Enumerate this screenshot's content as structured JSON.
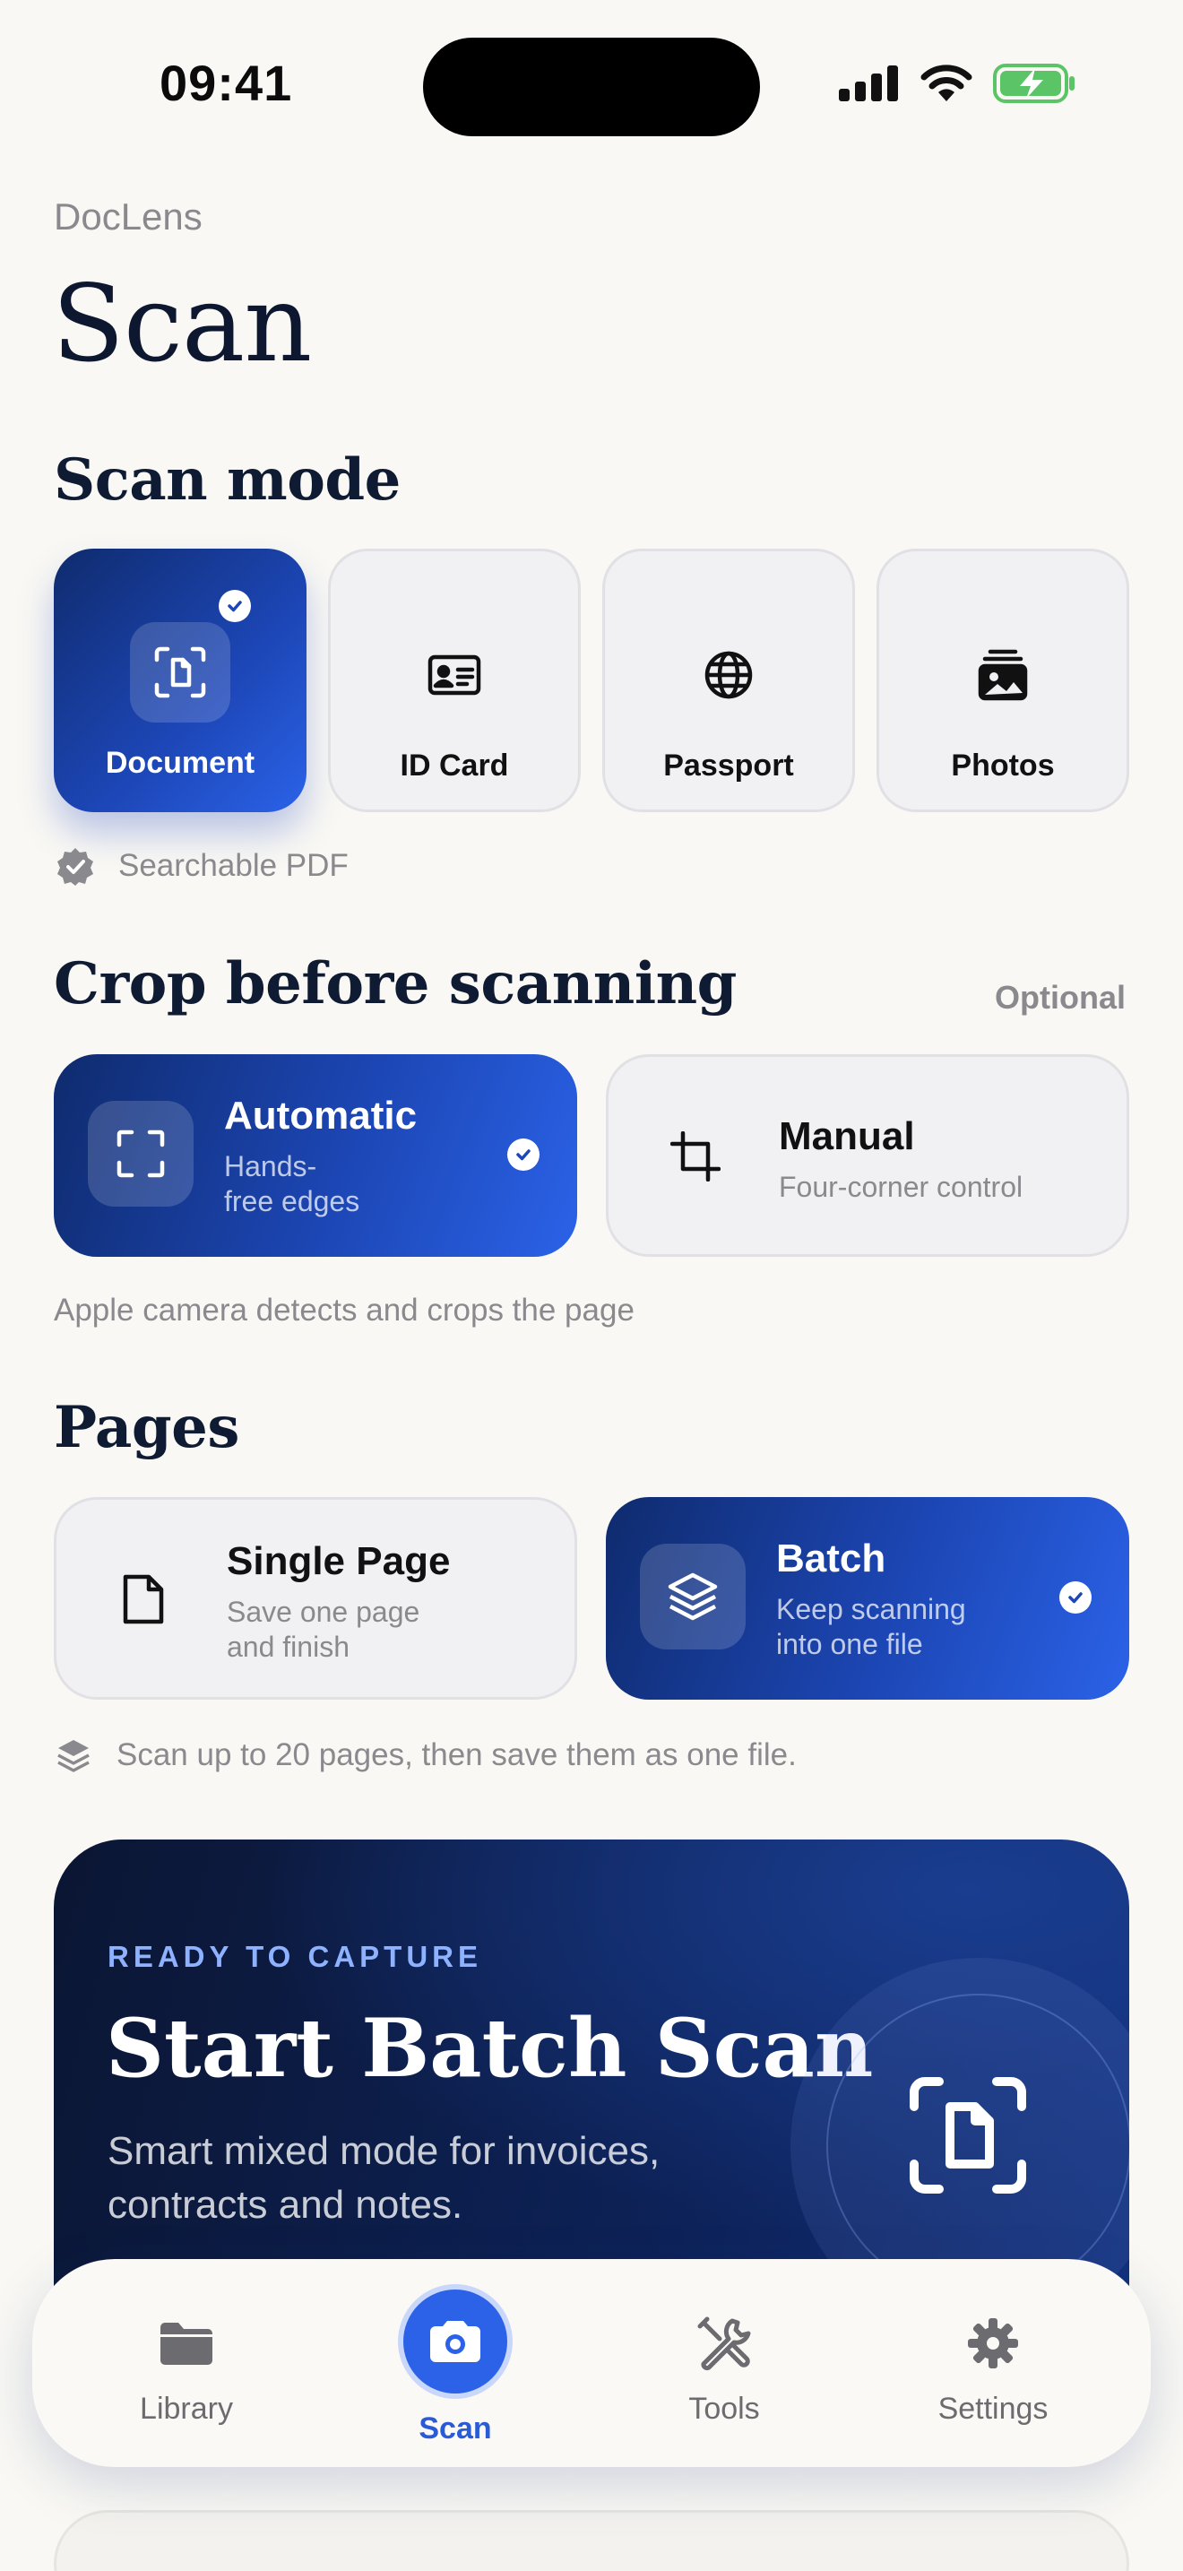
{
  "status": {
    "time": "09:41"
  },
  "header": {
    "brand": "DocLens",
    "title": "Scan"
  },
  "scan_mode": {
    "title": "Scan mode",
    "options": [
      {
        "label": "Document",
        "icon": "document-scan-icon",
        "selected": true
      },
      {
        "label": "ID Card",
        "icon": "id-card-icon",
        "selected": false
      },
      {
        "label": "Passport",
        "icon": "globe-icon",
        "selected": false
      },
      {
        "label": "Photos",
        "icon": "photos-icon",
        "selected": false
      }
    ],
    "hint": "Searchable PDF"
  },
  "crop": {
    "title": "Crop before scanning",
    "badge": "Optional",
    "options": [
      {
        "title": "Automatic",
        "subtitle_line1": "Hands-",
        "subtitle_line2": "free edges",
        "selected": true
      },
      {
        "title": "Manual",
        "subtitle_line1": "Four-corner control",
        "selected": false
      }
    ],
    "hint": "Apple camera detects and crops the page"
  },
  "pages": {
    "title": "Pages",
    "options": [
      {
        "title": "Single Page",
        "subtitle_line1": "Save one page",
        "subtitle_line2": "and finish",
        "selected": false
      },
      {
        "title": "Batch",
        "subtitle_line1": "Keep scanning",
        "subtitle_line2": "into one file",
        "selected": true
      }
    ],
    "hint": "Scan up to 20 pages, then save them as one file."
  },
  "hero": {
    "eyebrow": "READY TO CAPTURE",
    "title": "Start Batch Scan",
    "subtitle": "Smart mixed mode for invoices, contracts and notes."
  },
  "tabbar": {
    "tabs": [
      {
        "label": "Library",
        "icon": "folder-icon"
      },
      {
        "label": "Scan",
        "icon": "camera-icon",
        "active": true
      },
      {
        "label": "Tools",
        "icon": "tools-icon"
      },
      {
        "label": "Settings",
        "icon": "gear-icon"
      }
    ]
  },
  "colors": {
    "accent": "#2b62e8",
    "accent_dark": "#0f2b6e",
    "background": "#f9f8f4",
    "text": "#0f1b33",
    "muted": "#8a8a8e"
  }
}
